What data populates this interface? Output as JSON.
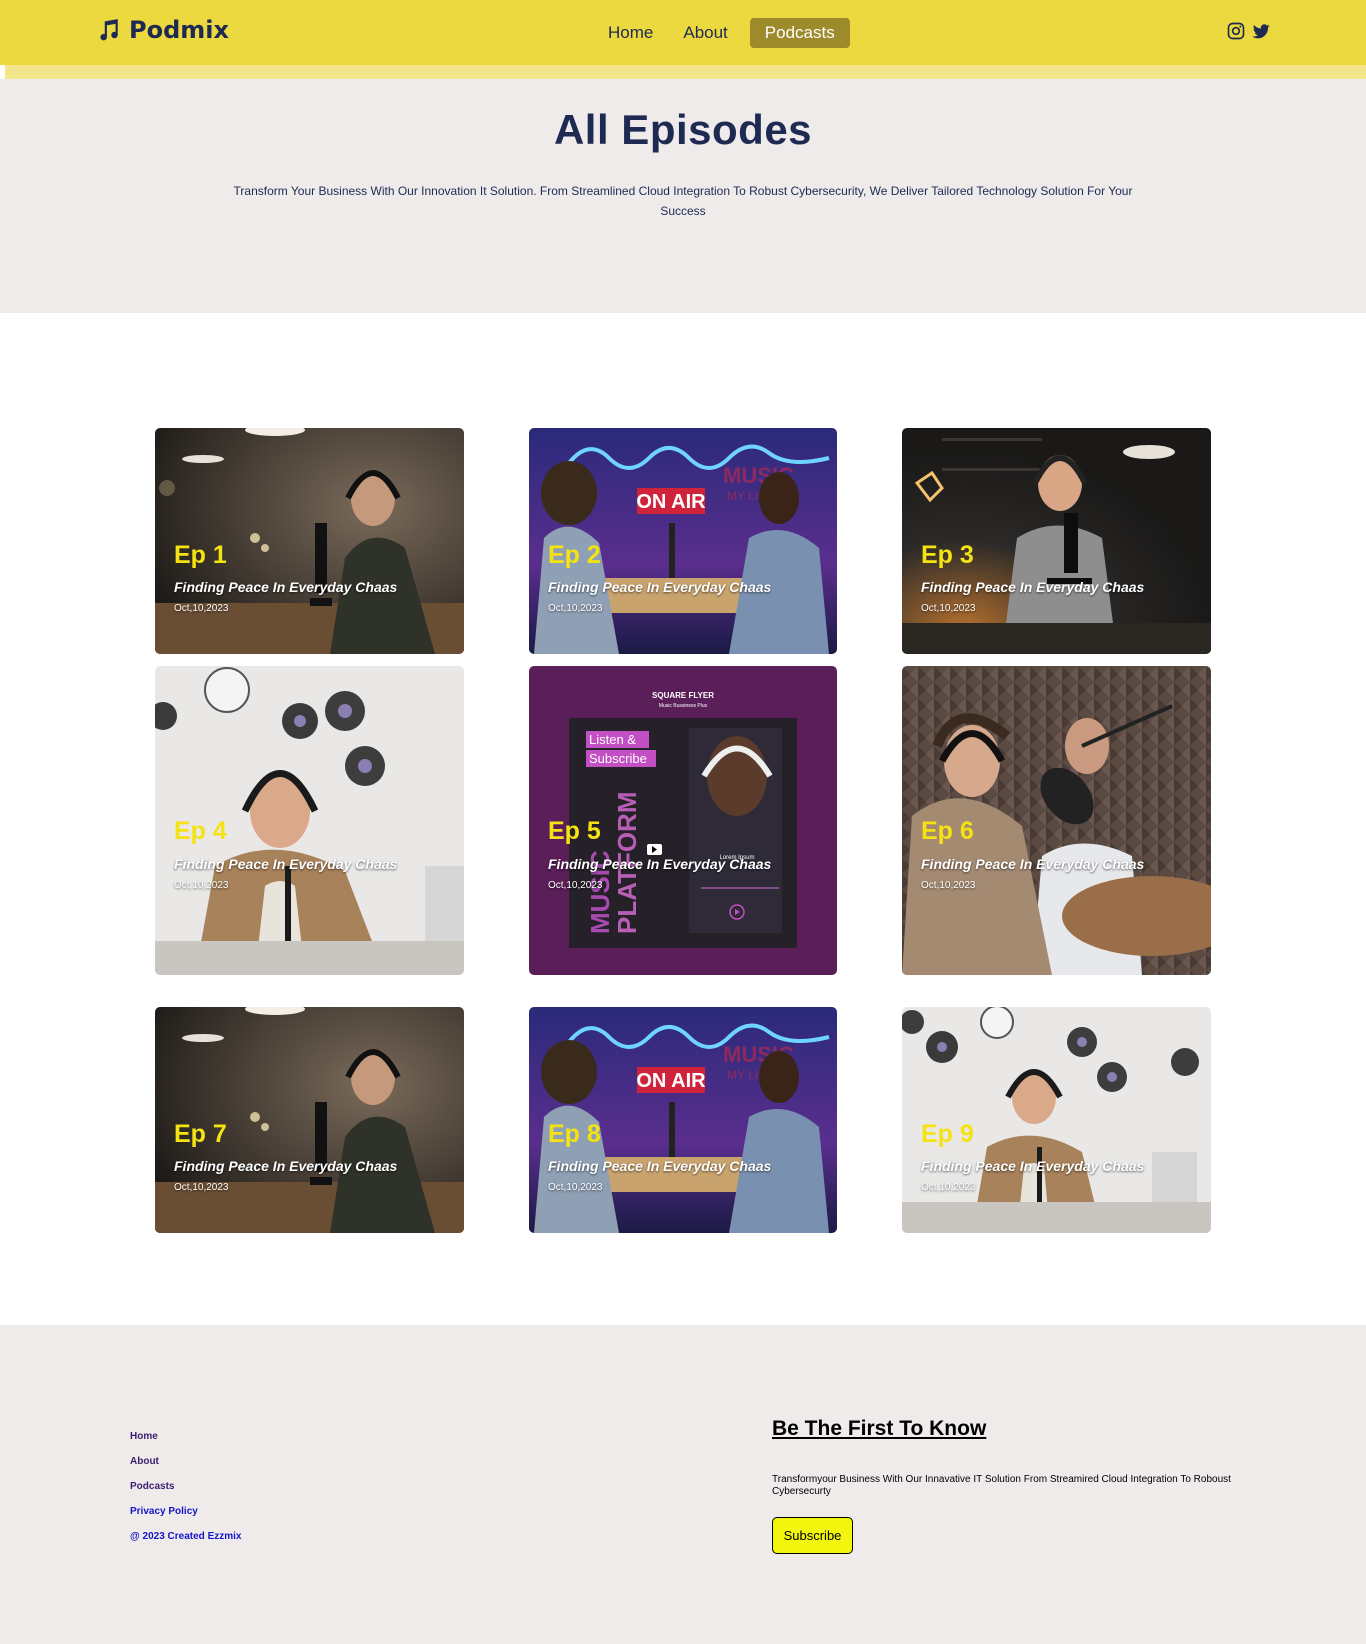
{
  "header": {
    "brand": "Podmix",
    "nav": [
      {
        "label": "Home",
        "active": false
      },
      {
        "label": "About",
        "active": false
      },
      {
        "label": "Podcasts",
        "active": true
      }
    ],
    "socials": [
      "instagram-icon",
      "twitter-icon"
    ],
    "colors": {
      "bar": "#ecd93f",
      "underbar": "#f3e68a",
      "active_tab": "#9d8a2a"
    }
  },
  "hero": {
    "title": "All Episodes",
    "subtitle": "Transform Your Business With Our Innovation It Solution. From Streamlined Cloud Integration To Robust Cybersecurity, We Deliver Tailored Technology Solution For Your Success"
  },
  "episodes": [
    {
      "ep": "Ep 1",
      "title": "Finding Peace In Everyday Chaas",
      "date": "Oct,10,2023"
    },
    {
      "ep": "Ep 2",
      "title": "Finding Peace In Everyday Chaas",
      "date": "Oct,10,2023"
    },
    {
      "ep": "Ep 3",
      "title": "Finding Peace In Everyday Chaas",
      "date": "Oct,10,2023"
    },
    {
      "ep": "Ep 4",
      "title": "Finding Peace In Everyday Chaas",
      "date": "Oct,10,2023"
    },
    {
      "ep": "Ep 5",
      "title": "Finding Peace In Everyday Chaas",
      "date": "Oct,10,2023"
    },
    {
      "ep": "Ep 6",
      "title": "Finding Peace In Everyday Chaas",
      "date": "Oct,10,2023"
    },
    {
      "ep": "Ep 7",
      "title": "Finding Peace In Everyday Chaas",
      "date": "Oct,10,2023"
    },
    {
      "ep": "Ep 8",
      "title": "Finding Peace In Everyday Chaas",
      "date": "Oct,10,2023"
    },
    {
      "ep": "Ep 9",
      "title": "Finding Peace In Everyday Chaas",
      "date": "Oct,10,2023"
    }
  ],
  "photo_text": {
    "on_air": "ON AIR",
    "music": "MUSIC",
    "my_life": "MY LIFE",
    "flyer_title": "SQUARE FLYER",
    "flyer_sub": "Music Bussiness Plus",
    "listen": "Listen &",
    "subscribe": "Subscribe",
    "platform": "PLATFORM",
    "music_vert": "MUSIC",
    "lorem": "Lorem Ipsum"
  },
  "footer": {
    "links": [
      "Home",
      "About",
      "Podcasts",
      "Privacy Policy",
      "@ 2023 Created Ezzmix"
    ],
    "newsletter_title": "Be The First To Know",
    "newsletter_text": "Transformyour Business With Our Innavative IT Solution From Streamired Cloud Integration To Roboust Cybersecurty",
    "subscribe_label": "Subscribe"
  },
  "colors": {
    "accent_yellow": "#f4e211",
    "navy": "#1e2a52",
    "hero_bg": "#efebeb",
    "subscribe_bg": "#f2f50d"
  }
}
